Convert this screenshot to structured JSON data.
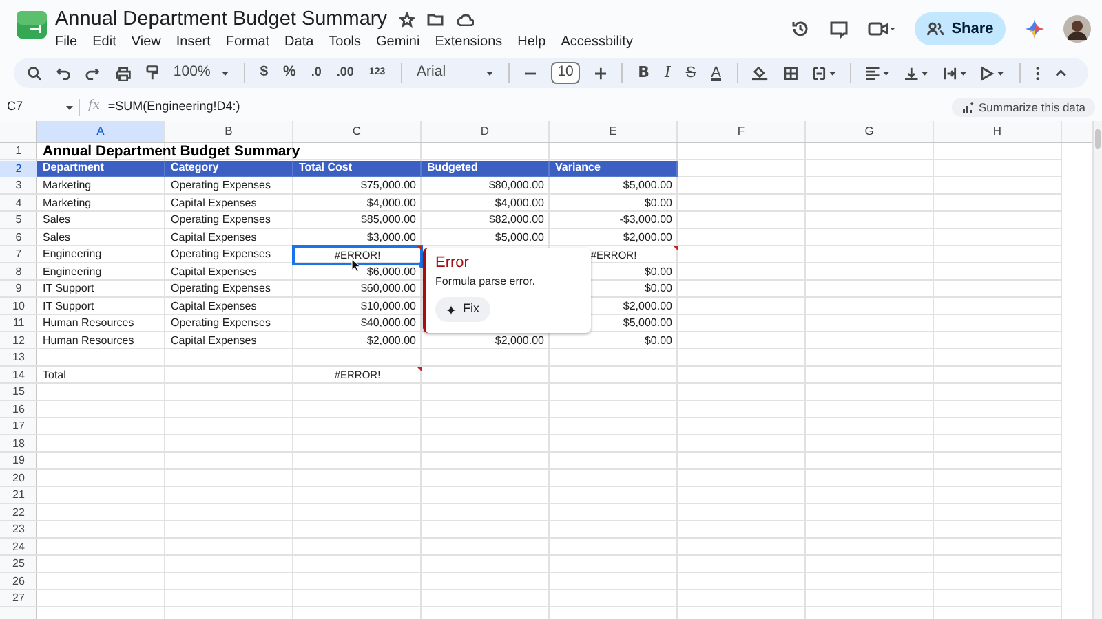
{
  "document": {
    "title": "Annual Department Budget Summary"
  },
  "menu": [
    "File",
    "Edit",
    "View",
    "Insert",
    "Format",
    "Data",
    "Tools",
    "Gemini",
    "Extensions",
    "Help",
    "Accessbility"
  ],
  "share_button": "Share",
  "toolbar": {
    "zoom": "100%",
    "currency": "$",
    "percent": "%",
    "decrease_decimal": ".0",
    "increase_decimal": ".00",
    "number_format": "123",
    "font": "Arial",
    "font_size": "10",
    "bold": "B",
    "italic": "I",
    "strikethrough": "S",
    "text_color": "A"
  },
  "formula_bar": {
    "name_box": "C7",
    "fx": "fx",
    "formula": "=SUM(Engineering!D4:)",
    "summarize_button": "Summarize this data"
  },
  "columns": [
    {
      "label": "A",
      "highlighted": true
    },
    {
      "label": "B",
      "highlighted": false
    },
    {
      "label": "C",
      "highlighted": false
    },
    {
      "label": "D",
      "highlighted": false
    },
    {
      "label": "E",
      "highlighted": false
    },
    {
      "label": "F",
      "highlighted": false
    },
    {
      "label": "G",
      "highlighted": false
    },
    {
      "label": "H",
      "highlighted": false
    }
  ],
  "rows": [
    {
      "number": "1",
      "highlighted": false,
      "kind": "title",
      "cells": [
        "Annual Department Budget Summary"
      ]
    },
    {
      "number": "2",
      "highlighted": true,
      "kind": "header",
      "cells": [
        "Department",
        "Category",
        "Total Cost",
        "Budgeted",
        "Variance"
      ]
    },
    {
      "number": "3",
      "highlighted": false,
      "kind": "data",
      "cells": [
        "Marketing",
        "Operating Expenses",
        "$75,000.00",
        "$80,000.00",
        "$5,000.00"
      ]
    },
    {
      "number": "4",
      "highlighted": false,
      "kind": "data",
      "cells": [
        "Marketing",
        "Capital Expenses",
        "$4,000.00",
        "$4,000.00",
        "$0.00"
      ]
    },
    {
      "number": "5",
      "highlighted": false,
      "kind": "data",
      "cells": [
        "Sales",
        "Operating Expenses",
        "$85,000.00",
        "$82,000.00",
        "-$3,000.00"
      ]
    },
    {
      "number": "6",
      "highlighted": false,
      "kind": "data",
      "cells": [
        "Sales",
        "Capital Expenses",
        "$3,000.00",
        "$5,000.00",
        "$2,000.00"
      ]
    },
    {
      "number": "7",
      "highlighted": false,
      "kind": "data",
      "cells": [
        "Engineering",
        "Operating Expenses",
        {
          "text": "#ERROR!",
          "error": true,
          "selected": true
        },
        null,
        {
          "text": "#ERROR!",
          "error": true,
          "selected": false
        }
      ]
    },
    {
      "number": "8",
      "highlighted": false,
      "kind": "data",
      "cells": [
        "Engineering",
        "Capital Expenses",
        "$6,000.00",
        null,
        "$0.00"
      ]
    },
    {
      "number": "9",
      "highlighted": false,
      "kind": "data",
      "cells": [
        "IT Support",
        "Operating Expenses",
        "$60,000.00",
        null,
        "$0.00"
      ]
    },
    {
      "number": "10",
      "highlighted": false,
      "kind": "data",
      "cells": [
        "IT Support",
        "Capital Expenses",
        "$10,000.00",
        null,
        "$2,000.00"
      ]
    },
    {
      "number": "11",
      "highlighted": false,
      "kind": "data",
      "cells": [
        "Human Resources",
        "Operating Expenses",
        "$40,000.00",
        null,
        "$5,000.00"
      ]
    },
    {
      "number": "12",
      "highlighted": false,
      "kind": "data",
      "cells": [
        "Human Resources",
        "Capital Expenses",
        "$2,000.00",
        "$2,000.00",
        "$0.00"
      ]
    },
    {
      "number": "13",
      "highlighted": false,
      "kind": "data",
      "cells": []
    },
    {
      "number": "14",
      "highlighted": false,
      "kind": "data",
      "cells": [
        "Total",
        null,
        {
          "text": "#ERROR!",
          "error": true,
          "selected": false
        }
      ]
    },
    {
      "number": "15",
      "highlighted": false,
      "kind": "data",
      "cells": []
    },
    {
      "number": "16",
      "highlighted": false,
      "kind": "data",
      "cells": []
    },
    {
      "number": "17",
      "highlighted": false,
      "kind": "data",
      "cells": []
    },
    {
      "number": "18",
      "highlighted": false,
      "kind": "data",
      "cells": []
    },
    {
      "number": "19",
      "highlighted": false,
      "kind": "data",
      "cells": []
    },
    {
      "number": "20",
      "highlighted": false,
      "kind": "data",
      "cells": []
    },
    {
      "number": "21",
      "highlighted": false,
      "kind": "data",
      "cells": []
    },
    {
      "number": "22",
      "highlighted": false,
      "kind": "data",
      "cells": []
    },
    {
      "number": "23",
      "highlighted": false,
      "kind": "data",
      "cells": []
    },
    {
      "number": "24",
      "highlighted": false,
      "kind": "data",
      "cells": []
    },
    {
      "number": "25",
      "highlighted": false,
      "kind": "data",
      "cells": []
    },
    {
      "number": "26",
      "highlighted": false,
      "kind": "data",
      "cells": []
    },
    {
      "number": "27",
      "highlighted": false,
      "kind": "data",
      "cells": []
    }
  ],
  "error_popup": {
    "title": "Error",
    "message": "Formula parse error.",
    "fix_button": "Fix"
  }
}
